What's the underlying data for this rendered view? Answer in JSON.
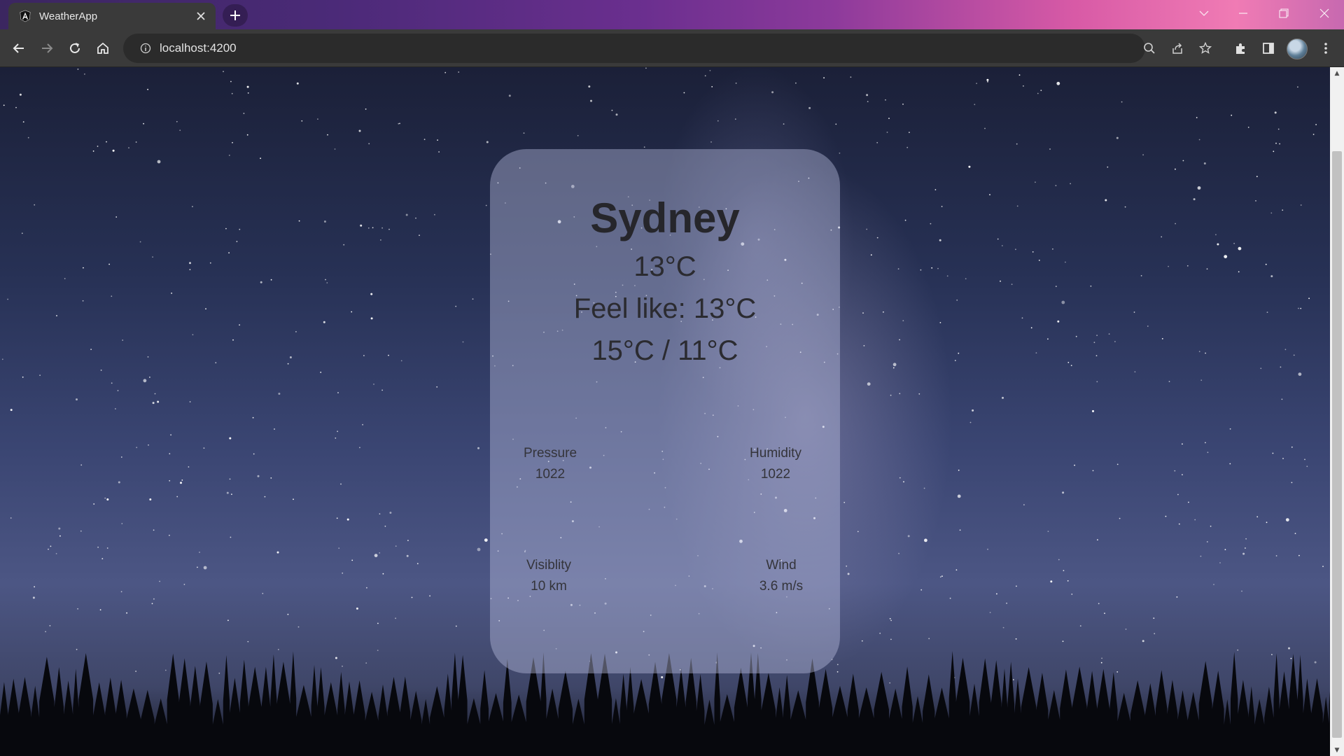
{
  "browser": {
    "tab_title": "WeatherApp",
    "url": "localhost:4200"
  },
  "weather": {
    "city": "Sydney",
    "temperature": "13°C",
    "feels_like": "Feel like: 13°C",
    "range": "15°C / 11°C",
    "stats": {
      "pressure": {
        "label": "Pressure",
        "value": "1022"
      },
      "humidity": {
        "label": "Humidity",
        "value": "1022"
      },
      "visibility": {
        "label": "Visiblity",
        "value": "10 km"
      },
      "wind": {
        "label": "Wind",
        "value": "3.6 m/s"
      }
    }
  },
  "icons": [
    "angular-logo-icon",
    "close-icon",
    "plus-icon",
    "chevron-down-icon",
    "minimize-icon",
    "restore-icon",
    "window-close-icon",
    "back-icon",
    "forward-icon",
    "reload-icon",
    "home-icon",
    "info-icon",
    "zoom-icon",
    "share-icon",
    "star-icon",
    "extensions-icon",
    "side-panel-icon",
    "avatar",
    "menu-icon"
  ]
}
